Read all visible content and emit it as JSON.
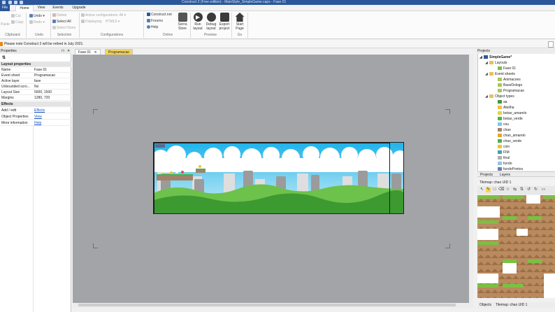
{
  "title_bar": {
    "text": "Construct 2 (Free edition) - MainStyle_SimpleGame.capx - Fase 01"
  },
  "menu_tabs": [
    "File",
    "Home",
    "View",
    "Events",
    "Upgrade"
  ],
  "ribbon": {
    "clipboard": {
      "paste": "Paste",
      "cut": "Cut",
      "copy": "Copy",
      "group": "Clipboard"
    },
    "undo": {
      "undo": "Undo",
      "redo": "Redo",
      "group": "Undo"
    },
    "selection": {
      "delete": "Delete",
      "select_all": "Select All",
      "select_none": "Select None",
      "group": "Selection"
    },
    "configurations": {
      "active": "Active configurations: All",
      "displaying": "Displaying:",
      "displaying_value": "HTML5",
      "group": "Configurations"
    },
    "online": {
      "construct_net": "Construct.net",
      "forums": "Forums",
      "help": "Help",
      "scirra_store": "Scirra Store",
      "group": "Online"
    },
    "preview": {
      "run_layout": "Run layout",
      "debug_layout": "Debug layout",
      "export_project": "Export project",
      "group": "Preview"
    },
    "go": {
      "start_page": "Start Page",
      "group": "Go"
    }
  },
  "notice": {
    "text": "Please note Construct 2 will be retired in July 2021."
  },
  "properties": {
    "title": "Properties",
    "section": "Layout properties",
    "rows": [
      {
        "key": "Name",
        "value": "Fase 01"
      },
      {
        "key": "Event sheet",
        "value": "Programacao"
      },
      {
        "key": "Active layer",
        "value": "fase"
      },
      {
        "key": "Unbounded scro...",
        "value": "No"
      },
      {
        "key": "Layout Size",
        "value": "5000, 1500"
      },
      {
        "key": "Margins",
        "value": "1280, 720"
      }
    ],
    "effects_section": "Effects",
    "effects_row": {
      "key": "Add / edit",
      "value": "Effects"
    },
    "object_row": {
      "key": "Object Properties",
      "value": "View"
    },
    "more_row": {
      "key": "More information",
      "value": "Help"
    }
  },
  "doc_tabs": [
    "Fase 01",
    "Programacao"
  ],
  "projects": {
    "title": "Projects",
    "root": "SimpleGame*",
    "layouts_label": "Layouts",
    "layouts": [
      "Fase 01"
    ],
    "event_sheets_label": "Event sheets",
    "event_sheets": [
      "Animacoes",
      "BaseDologo",
      "Programacao"
    ],
    "object_types_label": "Object types",
    "objects": [
      {
        "name": "aa",
        "color": "#3c9a3c"
      },
      {
        "name": "Abelha",
        "color": "#f1c33a"
      },
      {
        "name": "botao_amarelo",
        "color": "#e6d24a"
      },
      {
        "name": "botao_verde",
        "color": "#54b44a"
      },
      {
        "name": "ceu",
        "color": "#7bc8ef"
      },
      {
        "name": "chao",
        "color": "#a0836a"
      },
      {
        "name": "chao_amarelo",
        "color": "#e0a92a"
      },
      {
        "name": "chao_verde",
        "color": "#4caf50"
      },
      {
        "name": "coin",
        "color": "#f2c230"
      },
      {
        "name": "FIM",
        "color": "#3aa6a6"
      },
      {
        "name": "final",
        "color": "#b0b0b0"
      },
      {
        "name": "fundo",
        "color": "#8fc5e8"
      },
      {
        "name": "fundoPontos",
        "color": "#6d7da8"
      }
    ]
  },
  "right_tabs": [
    "Projects",
    "Layers"
  ],
  "tilemap": {
    "title": "Tilemap: chao UID 1"
  },
  "bottom_tabs": [
    "Objects",
    "Tilemap: chao UID 1"
  ],
  "colors": {
    "accent": "#2b579a",
    "canvas_bg": "#a2a4a8",
    "sky": "#49c4ee",
    "grass": "#3c9a30"
  }
}
